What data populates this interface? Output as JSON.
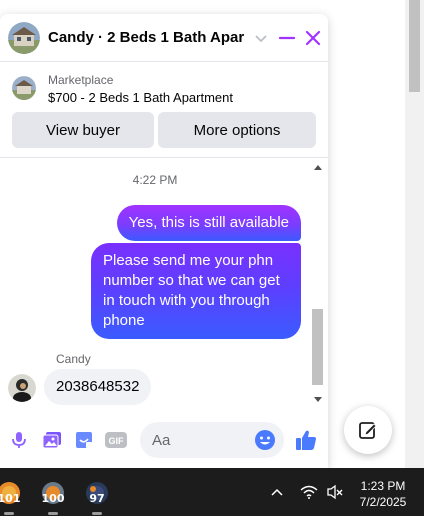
{
  "chat": {
    "title": "Candy · 2 Beds 1 Bath Apar...",
    "header_icons": [
      "chevron-down-icon",
      "minimize-icon",
      "close-icon"
    ]
  },
  "marketplace": {
    "label": "Marketplace",
    "listing": "$700 - 2 Beds 1 Bath Apartment",
    "view_buyer": "View buyer",
    "more_options": "More options"
  },
  "messages": {
    "timestamp": "4:22 PM",
    "outgoing": [
      "Yes, this is still available",
      "Please send me your phn number so that we can get in touch with you through phone"
    ],
    "sender_name": "Candy",
    "incoming": "2038648532"
  },
  "composer": {
    "placeholder": "Aa",
    "icons": [
      "microphone-icon",
      "photo-icon",
      "sticker-icon",
      "gif-icon",
      "emoji-icon",
      "thumbs-up-icon"
    ],
    "gif_label": "GIF"
  },
  "taskbar": {
    "apps": [
      {
        "name": "weather-app",
        "value": "101"
      },
      {
        "name": "weather-app",
        "value": "100"
      },
      {
        "name": "weather-app",
        "value": "97"
      }
    ],
    "time": "1:23 PM",
    "date": "7/2/2025"
  },
  "colors": {
    "accent": "#a033ff",
    "brand_blue": "#0866ff",
    "taskbar": "#1c1c1c"
  }
}
